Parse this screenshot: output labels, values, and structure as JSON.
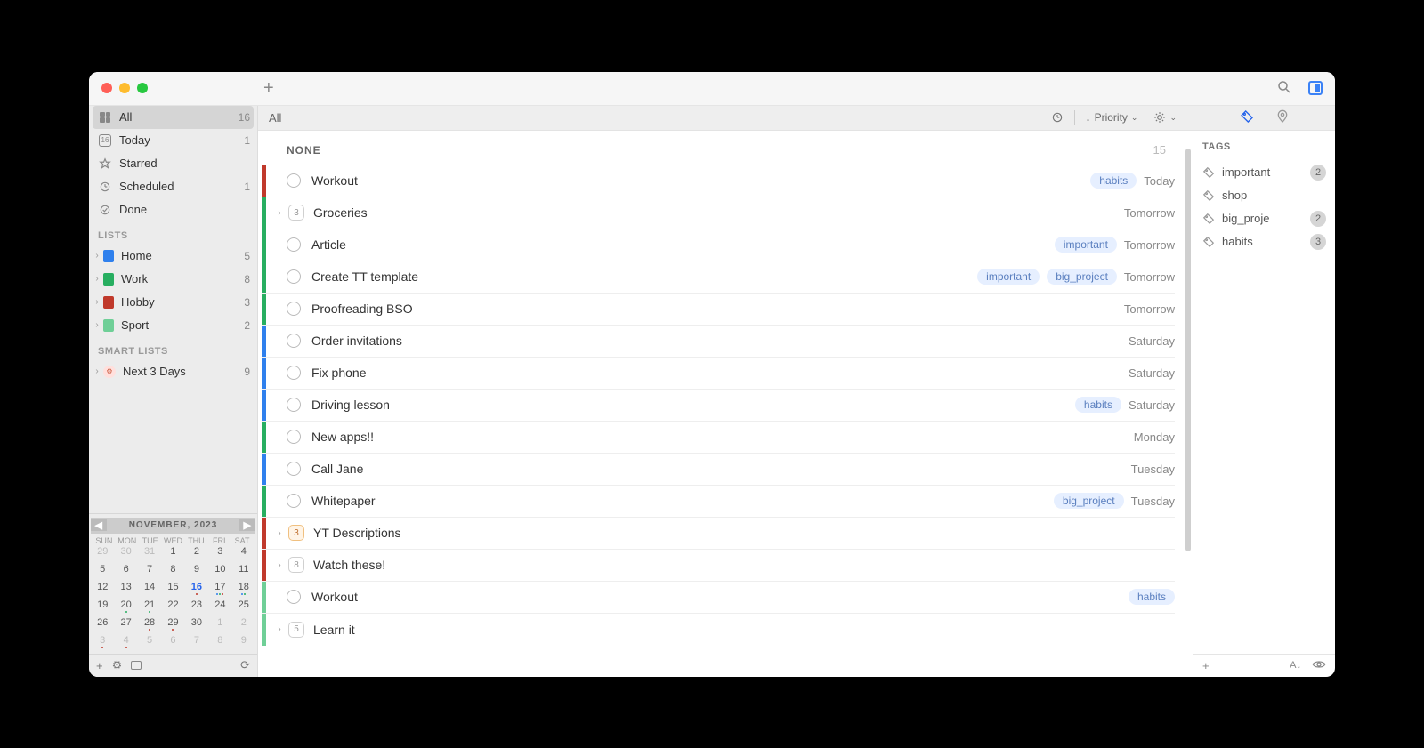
{
  "toolbar": {
    "title": "",
    "search_placeholder": "Search"
  },
  "sidebar": {
    "smart": [
      {
        "id": "all",
        "label": "All",
        "count": "16",
        "selected": true,
        "icon": "grid"
      },
      {
        "id": "today",
        "label": "Today",
        "count": "1",
        "icon": "calendar-day",
        "badge": "16"
      },
      {
        "id": "starred",
        "label": "Starred",
        "count": "",
        "icon": "star"
      },
      {
        "id": "scheduled",
        "label": "Scheduled",
        "count": "1",
        "icon": "clock"
      },
      {
        "id": "done",
        "label": "Done",
        "count": "",
        "icon": "check-circle"
      }
    ],
    "lists_header": "LISTS",
    "lists": [
      {
        "label": "Home",
        "count": "5",
        "color": "#2f80ed"
      },
      {
        "label": "Work",
        "count": "8",
        "color": "#27ae60"
      },
      {
        "label": "Hobby",
        "count": "3",
        "color": "#c0392b"
      },
      {
        "label": "Sport",
        "count": "2",
        "color": "#6fcf97"
      }
    ],
    "smartlists_header": "SMART LISTS",
    "smartlists": [
      {
        "label": "Next 3 Days",
        "count": "9"
      }
    ]
  },
  "calendar": {
    "title": "NOVEMBER, 2023",
    "dow": [
      "SUN",
      "MON",
      "TUE",
      "WED",
      "THU",
      "FRI",
      "SAT"
    ],
    "cells": [
      {
        "n": "29",
        "muted": true
      },
      {
        "n": "30",
        "muted": true
      },
      {
        "n": "31",
        "muted": true
      },
      {
        "n": "1"
      },
      {
        "n": "2"
      },
      {
        "n": "3"
      },
      {
        "n": "4"
      },
      {
        "n": "5"
      },
      {
        "n": "6"
      },
      {
        "n": "7"
      },
      {
        "n": "8"
      },
      {
        "n": "9"
      },
      {
        "n": "10"
      },
      {
        "n": "11"
      },
      {
        "n": "12"
      },
      {
        "n": "13"
      },
      {
        "n": "14"
      },
      {
        "n": "15"
      },
      {
        "n": "16",
        "today": true,
        "dots": [
          "#c0392b"
        ]
      },
      {
        "n": "17",
        "dots": [
          "#2f80ed",
          "#27ae60",
          "#c0392b"
        ]
      },
      {
        "n": "18",
        "dots": [
          "#2f80ed",
          "#27ae60"
        ]
      },
      {
        "n": "19"
      },
      {
        "n": "20",
        "dots": [
          "#27ae60"
        ]
      },
      {
        "n": "21",
        "dots": [
          "#27ae60"
        ]
      },
      {
        "n": "22"
      },
      {
        "n": "23"
      },
      {
        "n": "24"
      },
      {
        "n": "25"
      },
      {
        "n": "26"
      },
      {
        "n": "27"
      },
      {
        "n": "28",
        "dots": [
          "#c0392b"
        ]
      },
      {
        "n": "29",
        "dots": [
          "#c0392b"
        ]
      },
      {
        "n": "30"
      },
      {
        "n": "1",
        "muted": true
      },
      {
        "n": "2",
        "muted": true
      },
      {
        "n": "3",
        "muted": true,
        "dots": [
          "#c0392b"
        ]
      },
      {
        "n": "4",
        "muted": true,
        "dots": [
          "#c0392b"
        ]
      },
      {
        "n": "5",
        "muted": true
      },
      {
        "n": "6",
        "muted": true
      },
      {
        "n": "7",
        "muted": true
      },
      {
        "n": "8",
        "muted": true
      },
      {
        "n": "9",
        "muted": true
      }
    ]
  },
  "main": {
    "header_title": "All",
    "sort_label": "Priority",
    "section": {
      "title": "NONE",
      "count": "15"
    },
    "tasks": [
      {
        "title": "Workout",
        "stripe": "#c0392b",
        "tags": [
          "habits"
        ],
        "due": "Today",
        "check": true
      },
      {
        "title": "Groceries",
        "stripe": "#27ae60",
        "sub": "3",
        "chev": true,
        "due": "Tomorrow"
      },
      {
        "title": "Article",
        "stripe": "#27ae60",
        "tags": [
          "important"
        ],
        "due": "Tomorrow",
        "check": true
      },
      {
        "title": "Create TT template",
        "stripe": "#27ae60",
        "tags": [
          "important",
          "big_project"
        ],
        "due": "Tomorrow",
        "check": true
      },
      {
        "title": "Proofreading BSO",
        "stripe": "#27ae60",
        "due": "Tomorrow",
        "check": true
      },
      {
        "title": "Order invitations",
        "stripe": "#2f80ed",
        "due": "Saturday",
        "check": true
      },
      {
        "title": "Fix phone",
        "stripe": "#2f80ed",
        "due": "Saturday",
        "check": true
      },
      {
        "title": "Driving lesson",
        "stripe": "#2f80ed",
        "tags": [
          "habits"
        ],
        "due": "Saturday",
        "check": true
      },
      {
        "title": "New apps!!",
        "stripe": "#27ae60",
        "due": "Monday",
        "check": true
      },
      {
        "title": "Call Jane",
        "stripe": "#2f80ed",
        "due": "Tuesday",
        "check": true
      },
      {
        "title": "Whitepaper",
        "stripe": "#27ae60",
        "tags": [
          "big_project"
        ],
        "due": "Tuesday",
        "check": true
      },
      {
        "title": "YT Descriptions",
        "stripe": "#c0392b",
        "sub": "3",
        "warm": true,
        "chev": true
      },
      {
        "title": "Watch these!",
        "stripe": "#c0392b",
        "sub": "8",
        "chev": true
      },
      {
        "title": "Workout",
        "stripe": "#6fcf97",
        "tags": [
          "habits"
        ],
        "check": true
      },
      {
        "title": "Learn it",
        "stripe": "#6fcf97",
        "sub": "5",
        "chev": true
      }
    ]
  },
  "right": {
    "title": "TAGS",
    "tags": [
      {
        "label": "important",
        "count": "2"
      },
      {
        "label": "shop",
        "count": ""
      },
      {
        "label": "big_proje",
        "count": "2"
      },
      {
        "label": "habits",
        "count": "3"
      }
    ]
  }
}
